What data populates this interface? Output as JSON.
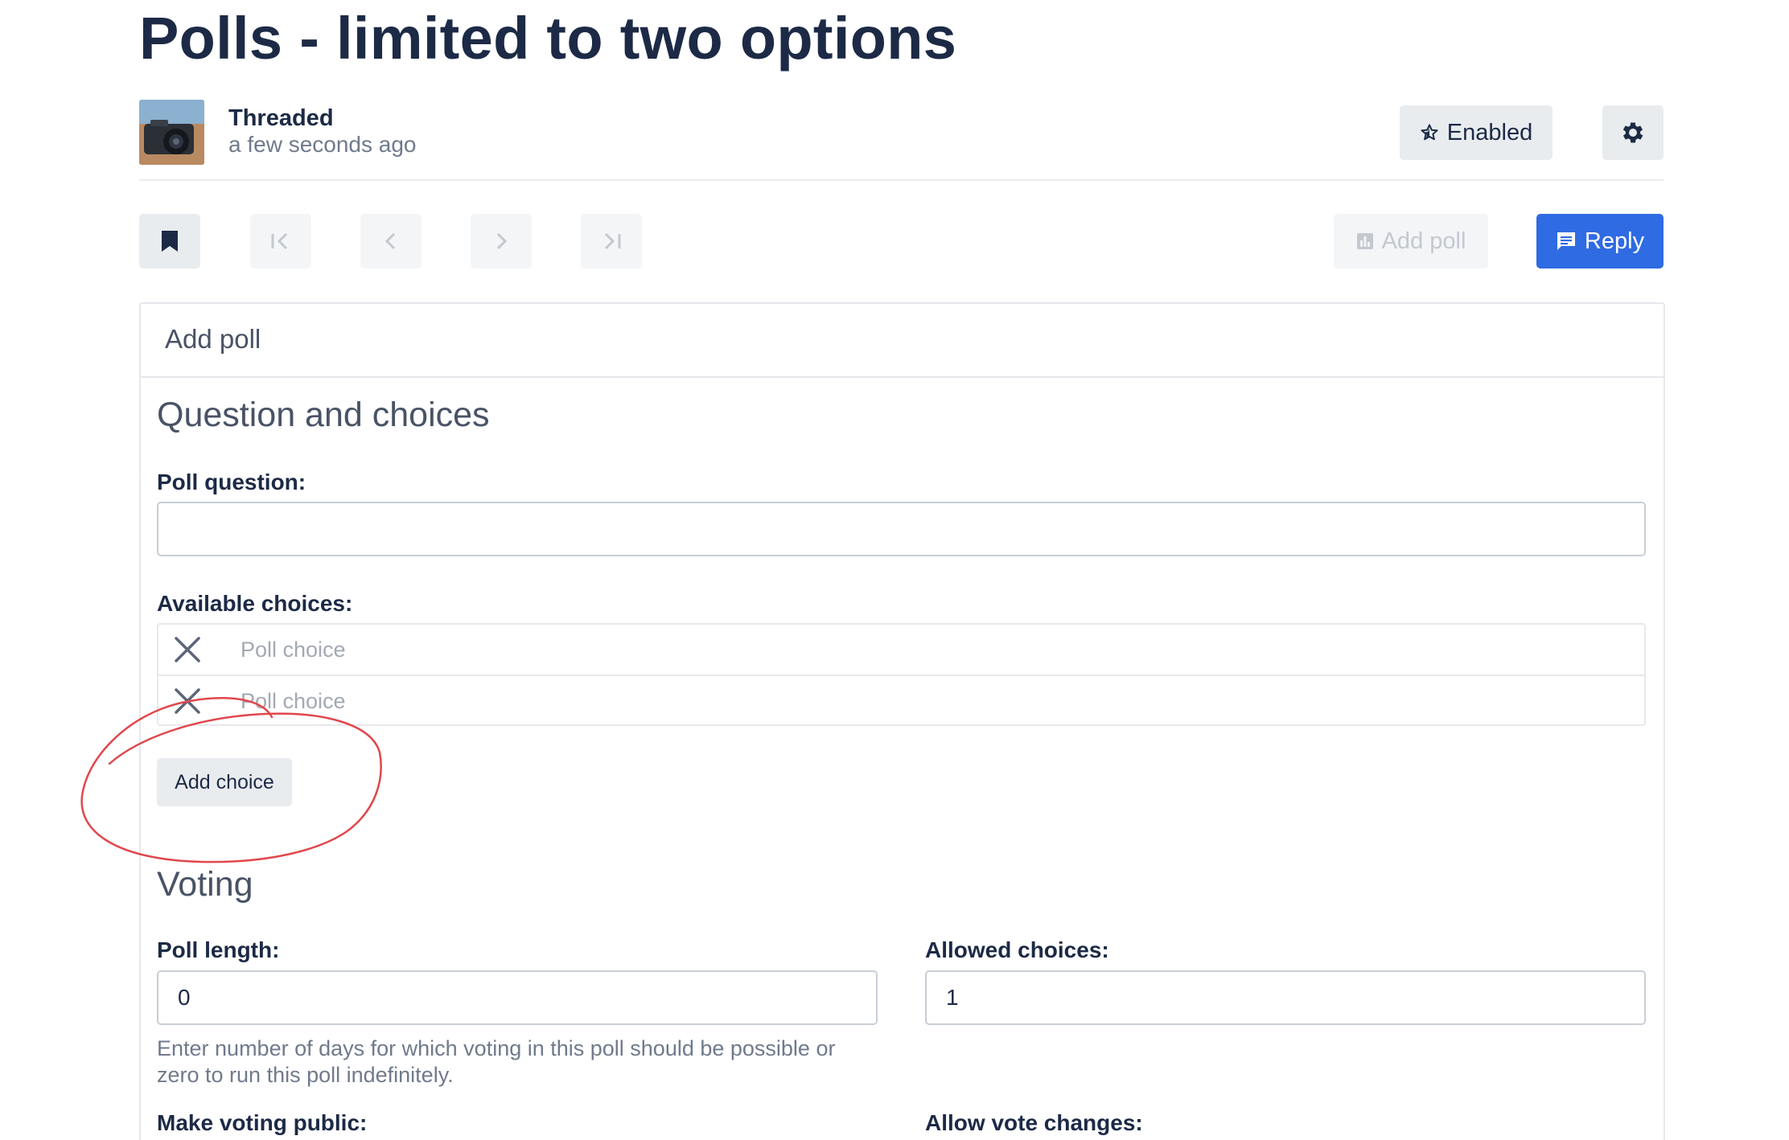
{
  "page": {
    "title": "Polls - limited to two options"
  },
  "thread": {
    "author": "Threaded",
    "posted": "a few seconds ago",
    "subscribe_label": "Enabled",
    "subscribe_icon": "star-icon",
    "settings_icon": "gear-icon"
  },
  "toolbar": {
    "bookmark_icon": "bookmark-icon",
    "nav_icons": [
      "first-page-icon",
      "previous-icon",
      "next-icon",
      "last-page-icon"
    ],
    "add_poll_label": "Add poll",
    "reply_label": "Reply",
    "reply_color": "#2f6be3"
  },
  "poll_form": {
    "header": "Add poll",
    "question_section": "Question and choices",
    "question_label": "Poll question:",
    "question_value": "",
    "choices_label": "Available choices:",
    "choices": [
      {
        "value": "",
        "placeholder": "Poll choice"
      },
      {
        "value": "",
        "placeholder": "Poll choice"
      }
    ],
    "add_choice_label": "Add choice",
    "voting_section": "Voting",
    "length_label": "Poll length:",
    "length_value": "0",
    "length_help": "Enter number of days for which voting in this poll should be possible or zero to run this poll indefinitely.",
    "allowed_label": "Allowed choices:",
    "allowed_value": "1",
    "public_label": "Make voting public:",
    "changes_label": "Allow vote changes:"
  },
  "annotation": {
    "color": "#e0474c",
    "target": "add-choice-button"
  }
}
